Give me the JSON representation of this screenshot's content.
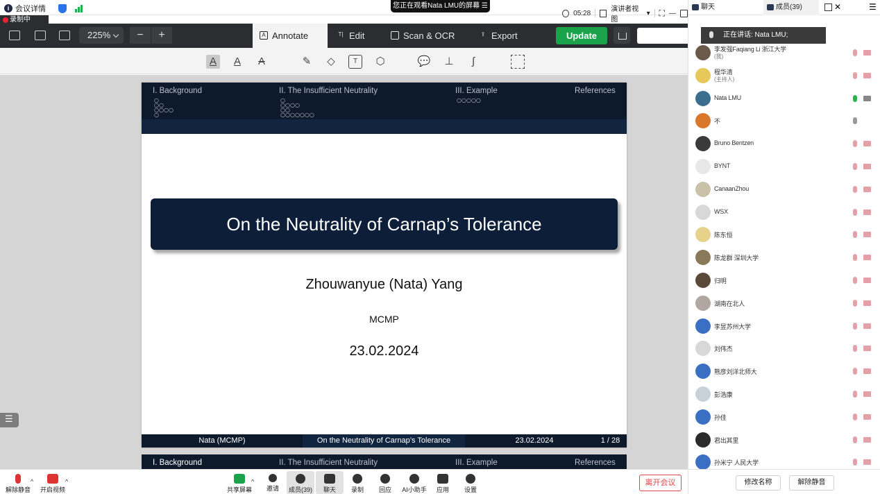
{
  "topbar": {
    "meeting_details": "会议详情",
    "viewing_banner": "您正在观看Nata LMU的屏幕",
    "time": "05:28",
    "view_mode": "演讲者视图"
  },
  "recording_label": "录制中",
  "apptool": {
    "zoom": "225%",
    "zoom_out": "−",
    "zoom_in": "+",
    "tabs": [
      "Annotate",
      "Edit",
      "Scan & OCR",
      "Export"
    ],
    "update": "Update"
  },
  "slide": {
    "sections": [
      "I. Background",
      "II. The Insufficient Neutrality",
      "III. Example",
      "References"
    ],
    "title": "On the Neutrality of Carnap’s Tolerance",
    "author": "Zhouwanyue (Nata) Yang",
    "institute": "MCMP",
    "date": "23.02.2024",
    "footer": {
      "left": "Nata  (MCMP)",
      "center": "On the Neutrality of Carnap’s Tolerance",
      "date": "23.02.2024",
      "page": "1 / 28"
    }
  },
  "controls": {
    "unmute": "解除静音",
    "video": "开启视频",
    "share": "共享屏幕",
    "invite": "邀请",
    "members": "成员(39)",
    "chat": "聊天",
    "record": "录制",
    "replay": "回应",
    "ai": "AI小助手",
    "apps": "应用",
    "settings": "设置",
    "leave": "离开会议"
  },
  "panel": {
    "tab_chat": "聊天",
    "tab_members": "成员(39)",
    "speaking": "正在讲话:  Nata LMU;",
    "members": [
      {
        "name": "李发强Faqiang Li 浙江大学",
        "sub": "(我)",
        "color": "#6a5a4a"
      },
      {
        "name": "程华清",
        "sub": "(主持人)",
        "color": "#e8c85a"
      },
      {
        "name": "Nata LMU",
        "sub": "",
        "color": "#3b6d8f"
      },
      {
        "name": "不",
        "sub": "",
        "color": "#d9772b"
      },
      {
        "name": "Bruno Bentzen",
        "sub": "",
        "color": "#3a3a3a"
      },
      {
        "name": "BYNT",
        "sub": "",
        "color": "#e8e8e8"
      },
      {
        "name": "CanaanZhou",
        "sub": "",
        "color": "#c9c2a8"
      },
      {
        "name": "WSX",
        "sub": "",
        "color": "#d8d8d8"
      },
      {
        "name": "陈东恒",
        "sub": "",
        "color": "#e6d28a"
      },
      {
        "name": "陈龙群 深圳大学",
        "sub": "",
        "color": "#8a7a5a"
      },
      {
        "name": "归明",
        "sub": "",
        "color": "#5a4a3a"
      },
      {
        "name": "湖南在北人",
        "sub": "",
        "color": "#b0a8a0"
      },
      {
        "name": "李昱苏州大学",
        "sub": "",
        "color": "#3a6fc4"
      },
      {
        "name": "刘伟杰",
        "sub": "",
        "color": "#d8d8d8"
      },
      {
        "name": "熊彦刘洋北师大",
        "sub": "",
        "color": "#3a6fc4"
      },
      {
        "name": "彭浩康",
        "sub": "",
        "color": "#c8d0d8"
      },
      {
        "name": "孙佳",
        "sub": "",
        "color": "#3a6fc4"
      },
      {
        "name": "君出其里",
        "sub": "",
        "color": "#2a2a2a"
      },
      {
        "name": "孙米宁 人民大学",
        "sub": "",
        "color": "#3a6fc4"
      }
    ],
    "rename": "修改名称",
    "unmute": "解除静音"
  }
}
